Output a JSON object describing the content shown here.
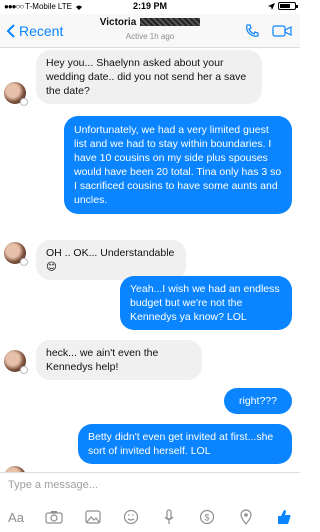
{
  "status_bar": {
    "carrier": "T-Mobile",
    "network": "LTE",
    "time": "2:19 PM"
  },
  "header": {
    "back_label": "Recent",
    "contact_name": "Victoria",
    "subtitle": "Active 1h ago"
  },
  "messages": [
    {
      "direction": "in",
      "text": "Hey you... Shaelynn asked about your wedding date.. did you not send her a save the date?"
    },
    {
      "direction": "out",
      "text": "Unfortunately, we had a very limited guest list and we had to stay within boundaries. I have 10 cousins on my side plus spouses would have been 20 total. Tina only has 3 so I sacrificed cousins to have some aunts and uncles."
    },
    {
      "direction": "in",
      "text": "OH .. OK... Understandable 😊"
    },
    {
      "direction": "out",
      "text": "Yeah...I wish we had an endless budget but we're not the Kennedys ya know? LOL"
    },
    {
      "direction": "in",
      "text": "heck... we ain't even the Kennedys help!"
    },
    {
      "direction": "out",
      "text": "right???"
    },
    {
      "direction": "out",
      "text": "Betty didn't even get invited at first...she sort of invited herself. LOL"
    }
  ],
  "composer": {
    "placeholder": "Type a message..."
  },
  "toolbar_icons": [
    "text-icon",
    "camera-icon",
    "photo-icon",
    "sticker-icon",
    "microphone-icon",
    "payment-icon",
    "location-icon",
    "like-icon"
  ],
  "colors": {
    "accent": "#0a84ff",
    "incoming_bubble": "#f0f0f0"
  }
}
